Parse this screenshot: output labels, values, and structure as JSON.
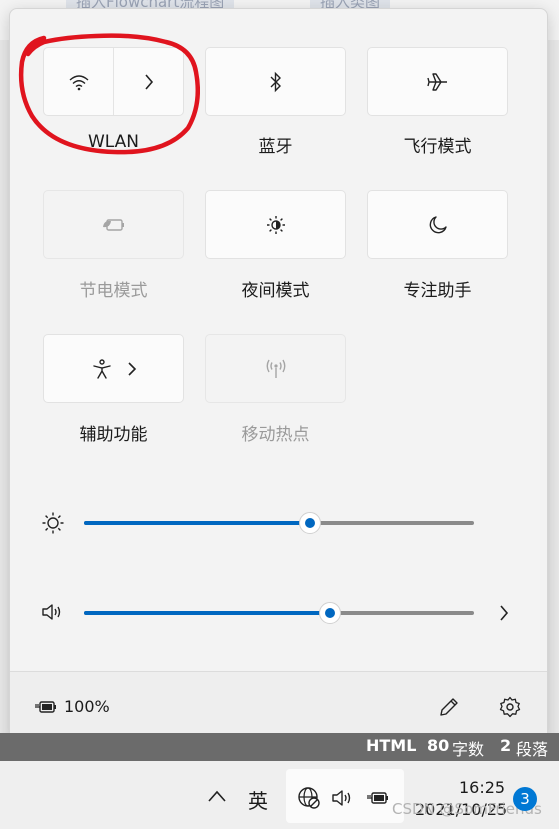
{
  "background": {
    "tabs": [
      "插入Flowchart流程图",
      "插入类图"
    ]
  },
  "tiles": [
    {
      "id": "wlan",
      "label": "WLAN",
      "icon": "wifi-icon",
      "split": true,
      "enabled": true
    },
    {
      "id": "bluetooth",
      "label": "蓝牙",
      "icon": "bluetooth-icon",
      "enabled": true
    },
    {
      "id": "airplane",
      "label": "飞行模式",
      "icon": "airplane-icon",
      "enabled": true
    },
    {
      "id": "battery-saver",
      "label": "节电模式",
      "icon": "battery-saver-icon",
      "enabled": false
    },
    {
      "id": "night-light",
      "label": "夜间模式",
      "icon": "night-light-icon",
      "enabled": true
    },
    {
      "id": "focus-assist",
      "label": "专注助手",
      "icon": "moon-icon",
      "enabled": true
    },
    {
      "id": "accessibility",
      "label": "辅助功能",
      "icon": "accessibility-icon",
      "split": true,
      "enabled": true
    },
    {
      "id": "mobile-hotspot",
      "label": "移动热点",
      "icon": "hotspot-icon",
      "enabled": false
    }
  ],
  "sliders": {
    "brightness": {
      "icon": "brightness-icon",
      "value": 0.58
    },
    "volume": {
      "icon": "speaker-icon",
      "value": 0.63
    }
  },
  "footer": {
    "battery_text": "100%",
    "battery_icon": "battery-charging-icon",
    "edit_icon": "pencil-icon",
    "settings_icon": "gear-icon"
  },
  "statusbar": {
    "format": "HTML",
    "word_count": "80",
    "word_unit": "字数",
    "para_count": "2",
    "para_unit": "段落"
  },
  "taskbar": {
    "ime": "英",
    "time": "16:25",
    "date": "2021/10/25",
    "notification_count": "3",
    "watermark": "CSDN @SomFriends"
  },
  "colors": {
    "accent": "#0067c0",
    "annotation": "#e0141e"
  }
}
